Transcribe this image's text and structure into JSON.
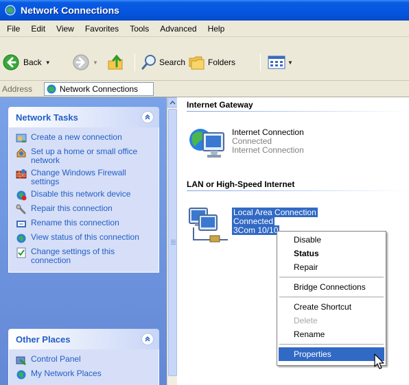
{
  "window": {
    "title": "Network Connections"
  },
  "menubar": {
    "items": [
      "File",
      "Edit",
      "View",
      "Favorites",
      "Tools",
      "Advanced",
      "Help"
    ]
  },
  "toolbar": {
    "back": "Back",
    "search": "Search",
    "folders": "Folders"
  },
  "address": {
    "label": "Address",
    "value": "Network Connections"
  },
  "network_tasks": {
    "title": "Network Tasks",
    "items": [
      {
        "label": "Create a new connection",
        "icon": "new-connection-icon"
      },
      {
        "label": "Set up a home or small office network",
        "icon": "home-network-icon"
      },
      {
        "label": "Change Windows Firewall settings",
        "icon": "firewall-icon"
      },
      {
        "label": "Disable this network device",
        "icon": "disable-device-icon"
      },
      {
        "label": "Repair this connection",
        "icon": "repair-icon"
      },
      {
        "label": "Rename this connection",
        "icon": "rename-icon"
      },
      {
        "label": "View status of this connection",
        "icon": "status-icon"
      },
      {
        "label": "Change settings of this connection",
        "icon": "settings-icon"
      }
    ]
  },
  "other_places": {
    "title": "Other Places",
    "items": [
      {
        "label": "Control Panel",
        "icon": "control-panel-icon"
      },
      {
        "label": "My Network Places",
        "icon": "network-places-icon"
      }
    ]
  },
  "groups": [
    {
      "title": "Internet Gateway",
      "item": {
        "name": "Internet Connection",
        "status": "Connected",
        "type": "Internet Connection"
      }
    },
    {
      "title": "LAN or High-Speed Internet",
      "item": {
        "name": "Local Area Connection",
        "status": "Connected",
        "type": "3Com 10/10"
      }
    }
  ],
  "context_menu": {
    "items": [
      "Disable",
      "Status",
      "Repair",
      "Bridge Connections",
      "Create Shortcut",
      "Delete",
      "Rename",
      "Properties"
    ]
  }
}
